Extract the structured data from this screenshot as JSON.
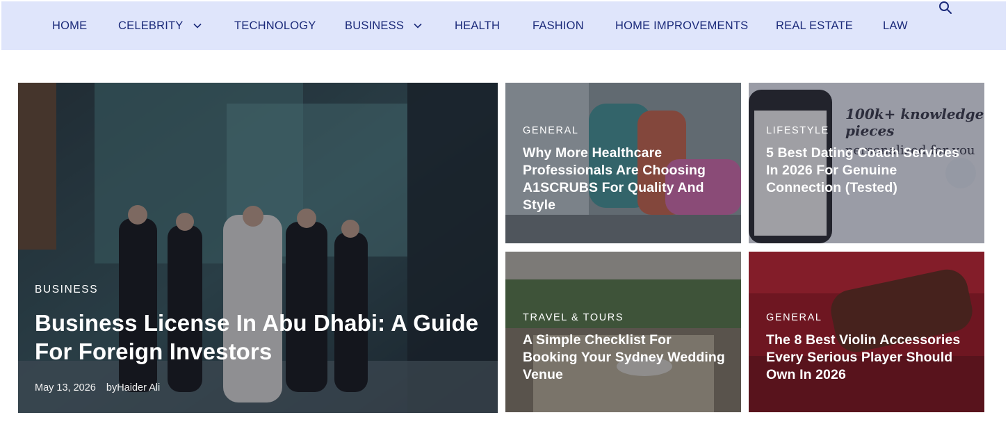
{
  "nav": {
    "items": [
      {
        "label": "HOME"
      },
      {
        "label": "CELEBRITY"
      },
      {
        "label": "TECHNOLOGY"
      },
      {
        "label": "BUSINESS"
      },
      {
        "label": "HEALTH"
      },
      {
        "label": "FASHION"
      },
      {
        "label": "HOME IMPROVEMENTS"
      },
      {
        "label": "REAL ESTATE"
      },
      {
        "label": "LAW"
      }
    ],
    "icons": {
      "dropdown": "chevron-down-icon",
      "search": "search-icon"
    },
    "colors": {
      "background": "#dfe5fb",
      "text": "#1b2a7a"
    }
  },
  "featured": {
    "category": "BUSINESS",
    "title": "Business License In Abu Dhabi: A Guide For Foreign Investors",
    "date": "May 13, 2026",
    "author": "byHaider Ali"
  },
  "cards": [
    {
      "category": "GENERAL",
      "title": "Why More Healthcare Professionals Are Choosing A1SCRUBS For Quality And Style"
    },
    {
      "category": "LIFESTYLE",
      "title": "5 Best Dating Coach Services In 2026 For Genuine Connection (Tested)",
      "image_text": [
        "100k+ knowledge pieces",
        "personalized for you"
      ]
    },
    {
      "category": "TRAVEL & TOURS",
      "title": "A Simple Checklist For Booking Your Sydney Wedding Venue"
    },
    {
      "category": "GENERAL",
      "title": "The 8 Best Violin Accessories Every Serious Player Should Own In 2026"
    }
  ]
}
